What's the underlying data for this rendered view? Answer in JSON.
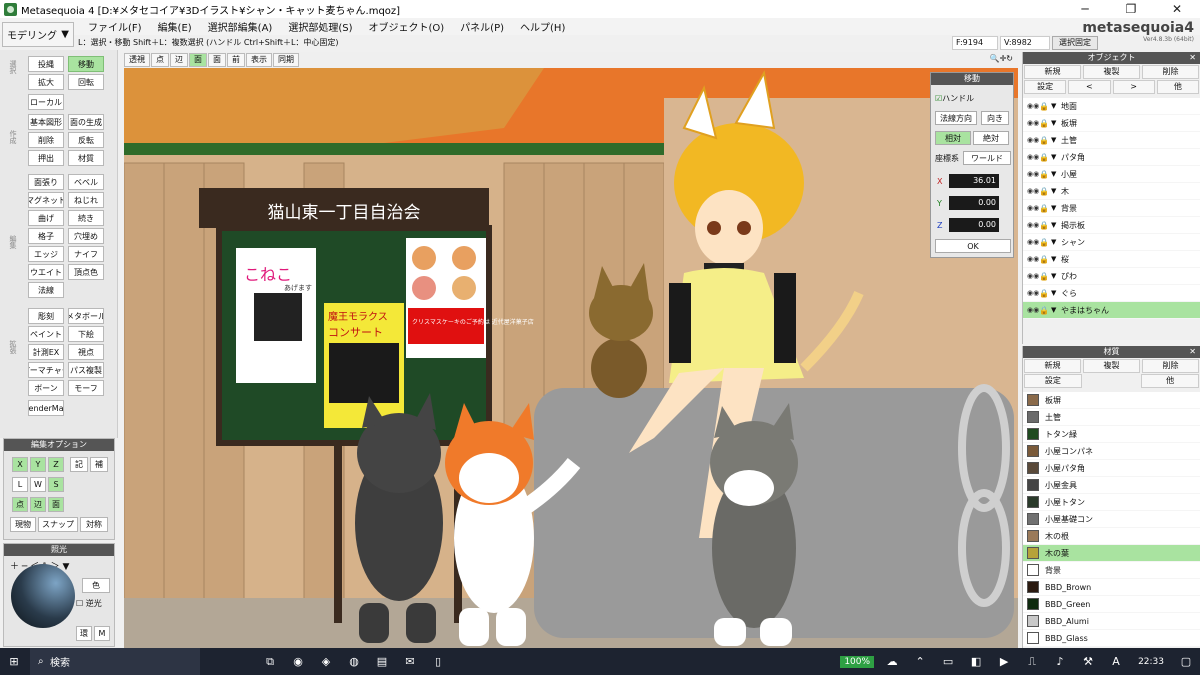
{
  "window": {
    "title": "Metasequoia 4 [D:¥メタセコイア¥3Dイラスト¥シャン・キャット麦ちゃん.mqoz]"
  },
  "mode": {
    "label": "モデリング"
  },
  "menu": [
    "ファイル(F)",
    "編集(E)",
    "選択部編集(A)",
    "選択部処理(S)",
    "オブジェクト(O)",
    "パネル(P)",
    "ヘルプ(H)"
  ],
  "logo": {
    "name": "metasequoia4",
    "version": "Ver4.8.3b (64bit)"
  },
  "cmdhint": "L：選択・移動  Shift＋L：複数選択 (ハンドル  Ctrl+Shift＋L：中心固定)",
  "counters": {
    "faces": "F:9194",
    "verts": "V:8982",
    "selfix": "選択固定"
  },
  "tools": [
    "投縄",
    "移動",
    "拡大",
    "回転",
    "ローカル",
    "基本図形",
    "面の生成",
    "削除",
    "反転",
    "押出",
    "材質",
    "面張り",
    "ベベル",
    "マグネット",
    "ねじれ",
    "曲げ",
    "続き",
    "格子",
    "穴埋め",
    "エッジ",
    "ナイフ",
    "ウエイト",
    "頂点色",
    "法線",
    "彫刻",
    "メタボール",
    "ペイント",
    "下絵",
    "計測EX",
    "視点",
    "アーマチャー",
    "パス複製",
    "ボーン",
    "モーフ",
    "RenderMan"
  ],
  "editopt": {
    "title": "編集オプション",
    "x": "X",
    "y": "Y",
    "z": "Z",
    "sym": "記",
    "cont": "補",
    "l": "L",
    "w": "W",
    "s": "S",
    "pt": "点",
    "edge": "辺",
    "face": "面",
    "cur": "現物",
    "snap": "スナップ",
    "mirror": "対称"
  },
  "light": {
    "title": "照光",
    "color": "色",
    "rev": "逆光",
    "env": "環",
    "m": "M"
  },
  "viewtool": [
    "透視",
    "点",
    "辺",
    "面",
    "面",
    "前",
    "表示",
    "同期"
  ],
  "move": {
    "title": "移動",
    "handle": "ハンドル",
    "normal": "法線方向",
    "dir": "向き",
    "rel": "相対",
    "abs": "絶対",
    "coord": "座標系",
    "world": "ワールド",
    "x": "X",
    "xv": "36.01",
    "y": "Y",
    "yv": "0.00",
    "z": "Z",
    "zv": "0.00",
    "ok": "OK"
  },
  "objects": {
    "title": "オブジェクト",
    "new": "新規",
    "copy": "複製",
    "del": "削除",
    "set": "設定",
    "prev": "<",
    "next": ">",
    "other": "他",
    "items": [
      "地面",
      "板塀",
      "土管",
      "パタ角",
      "小屋",
      "木",
      "背景",
      "掲示板",
      "シャン",
      "桜",
      "ぴわ",
      "ぐら",
      "やまはちゃん"
    ],
    "selected": "やまはちゃん"
  },
  "materials": {
    "title": "材質",
    "new": "新規",
    "copy": "複製",
    "del": "削除",
    "set": "設定",
    "other": "他",
    "items": [
      {
        "n": "板塀",
        "c": "#8a6a4a"
      },
      {
        "n": "土管",
        "c": "#6b6b6b"
      },
      {
        "n": "トタン緑",
        "c": "#1f4a1f"
      },
      {
        "n": "小屋コンパネ",
        "c": "#7a5a3a"
      },
      {
        "n": "小屋パタ角",
        "c": "#5a4a3a"
      },
      {
        "n": "小屋金具",
        "c": "#444444"
      },
      {
        "n": "小屋トタン",
        "c": "#2a3a2a"
      },
      {
        "n": "小屋基礎コン",
        "c": "#707070"
      },
      {
        "n": "木の根",
        "c": "#9a7a5a"
      },
      {
        "n": "木の葉",
        "c": "#b6a23a"
      },
      {
        "n": "背景",
        "c": "#ffffff"
      },
      {
        "n": "BBD_Brown",
        "c": "#2a1a10"
      },
      {
        "n": "BBD_Green",
        "c": "#0e2a0e"
      },
      {
        "n": "BBD_Alumi",
        "c": "#c8c8c8"
      },
      {
        "n": "BBD_Glass",
        "c": "#ffffff"
      }
    ],
    "selected": "木の葉"
  },
  "board": {
    "title": "猫山東一丁目自治会",
    "p1": "こねこ",
    "p1sub": "あげます",
    "p2a": "魔王モラクス",
    "p2b": "コンサート",
    "p3": "クリスマスケーキのご予約は 近代屋洋菓子店"
  },
  "taskbar": {
    "search": "検索",
    "zoom": "100%",
    "time": "22:33"
  }
}
